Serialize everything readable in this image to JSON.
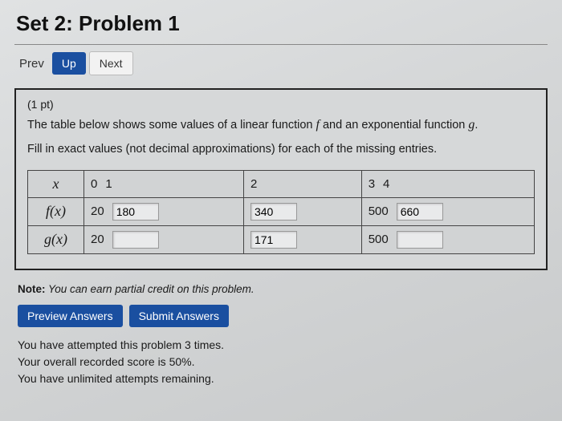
{
  "title": "Set 2: Problem 1",
  "nav": {
    "prev": "Prev",
    "up": "Up",
    "next": "Next"
  },
  "problem": {
    "points": "(1 pt)",
    "line1a": "The table below shows some values of a linear function ",
    "f": "f",
    "line1b": " and an exponential function ",
    "g": "g",
    "line1c": ".",
    "line2": "Fill in exact values (not decimal approximations) for each of the missing entries."
  },
  "table": {
    "row_x_label": "x",
    "row_f_label": "f(x)",
    "row_g_label": "g(x)",
    "x": {
      "c0": "0",
      "c1": "1",
      "c2": "2",
      "c3": "3",
      "c4": "4"
    },
    "f": {
      "c0": "20",
      "c1": "180",
      "c2": "340",
      "c3": "500",
      "c4": "660"
    },
    "g": {
      "c0": "20",
      "c1": "",
      "c2": "171",
      "c3": "500",
      "c4": ""
    }
  },
  "note_label": "Note:",
  "note_text": " You can earn partial credit on this problem.",
  "buttons": {
    "preview": "Preview Answers",
    "submit": "Submit Answers"
  },
  "status": {
    "attempts": "You have attempted this problem 3 times.",
    "score": "Your overall recorded score is 50%.",
    "remaining": "You have unlimited attempts remaining."
  }
}
